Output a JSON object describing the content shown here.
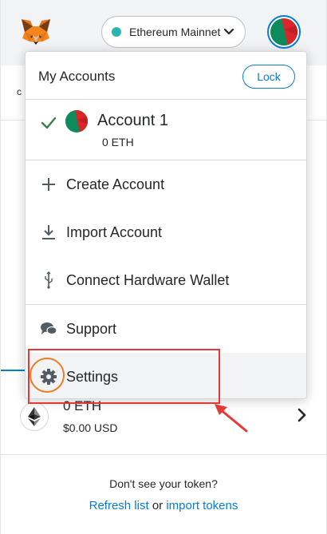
{
  "header": {
    "network_label": "Ethereum Mainnet",
    "network_dot_color": "#29b6af",
    "icons": [
      "metamask-fox-icon",
      "chevron-down-icon",
      "account-identicon"
    ]
  },
  "underlay": {
    "clipped_letter": "c"
  },
  "account_menu": {
    "title": "My Accounts",
    "lock_label": "Lock",
    "account": {
      "name": "Account 1",
      "balance": "0 ETH",
      "selected": true
    },
    "items": [
      {
        "label": "Create Account",
        "icon": "plus-icon"
      },
      {
        "label": "Import Account",
        "icon": "download-icon"
      },
      {
        "label": "Connect Hardware Wallet",
        "icon": "usb-icon"
      },
      {
        "label": "Support",
        "icon": "chat-bubbles-icon"
      },
      {
        "label": "Settings",
        "icon": "gear-icon"
      }
    ]
  },
  "asset": {
    "amount": "0 ETH",
    "usd": "$0.00 USD"
  },
  "footer": {
    "question": "Don't see your token?",
    "refresh_label": "Refresh list",
    "or_label": "or",
    "import_label": "import tokens"
  },
  "colors": {
    "accent": "#037dd6",
    "annotation_box": "#e53935",
    "annotation_ring": "#e67e22"
  }
}
